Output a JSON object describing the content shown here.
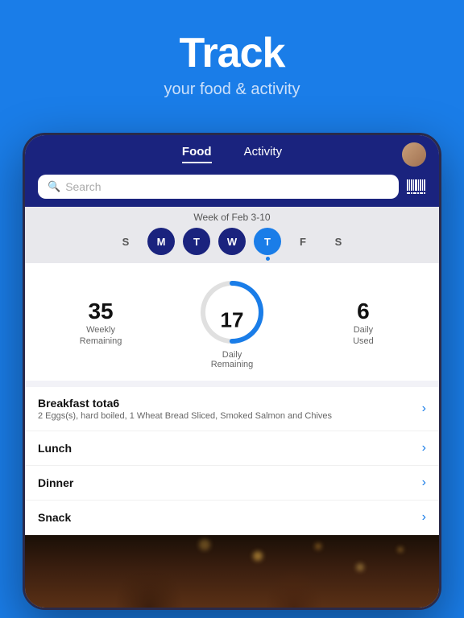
{
  "page": {
    "background_color": "#1a7de8",
    "title": "Track",
    "subtitle": "your food & activity"
  },
  "nav": {
    "food_tab": "Food",
    "activity_tab": "Activity",
    "search_placeholder": "Search",
    "active_tab": "food"
  },
  "week": {
    "label": "Week of Feb 3-10",
    "days": [
      {
        "letter": "S",
        "state": "normal"
      },
      {
        "letter": "M",
        "state": "filled"
      },
      {
        "letter": "T",
        "state": "filled"
      },
      {
        "letter": "W",
        "state": "filled"
      },
      {
        "letter": "T",
        "state": "active"
      },
      {
        "letter": "F",
        "state": "normal"
      },
      {
        "letter": "S",
        "state": "normal"
      }
    ]
  },
  "daily_stats": {
    "weekly_remaining": "35",
    "weekly_label": "Weekly\nRemaining",
    "daily_remaining": "17",
    "daily_label": "Daily\nRemaining",
    "daily_used": "6",
    "daily_used_label": "Daily\nUsed"
  },
  "meals": [
    {
      "name": "Breakfast tota6",
      "detail": "2 Eggs(s), hard boiled, 1 Wheat Bread Sliced, Smoked Salmon and Chives",
      "has_chevron": true
    },
    {
      "name": "Lunch",
      "detail": "",
      "has_chevron": true
    },
    {
      "name": "Dinner",
      "detail": "",
      "has_chevron": true
    },
    {
      "name": "Snack",
      "detail": "",
      "has_chevron": true
    }
  ]
}
